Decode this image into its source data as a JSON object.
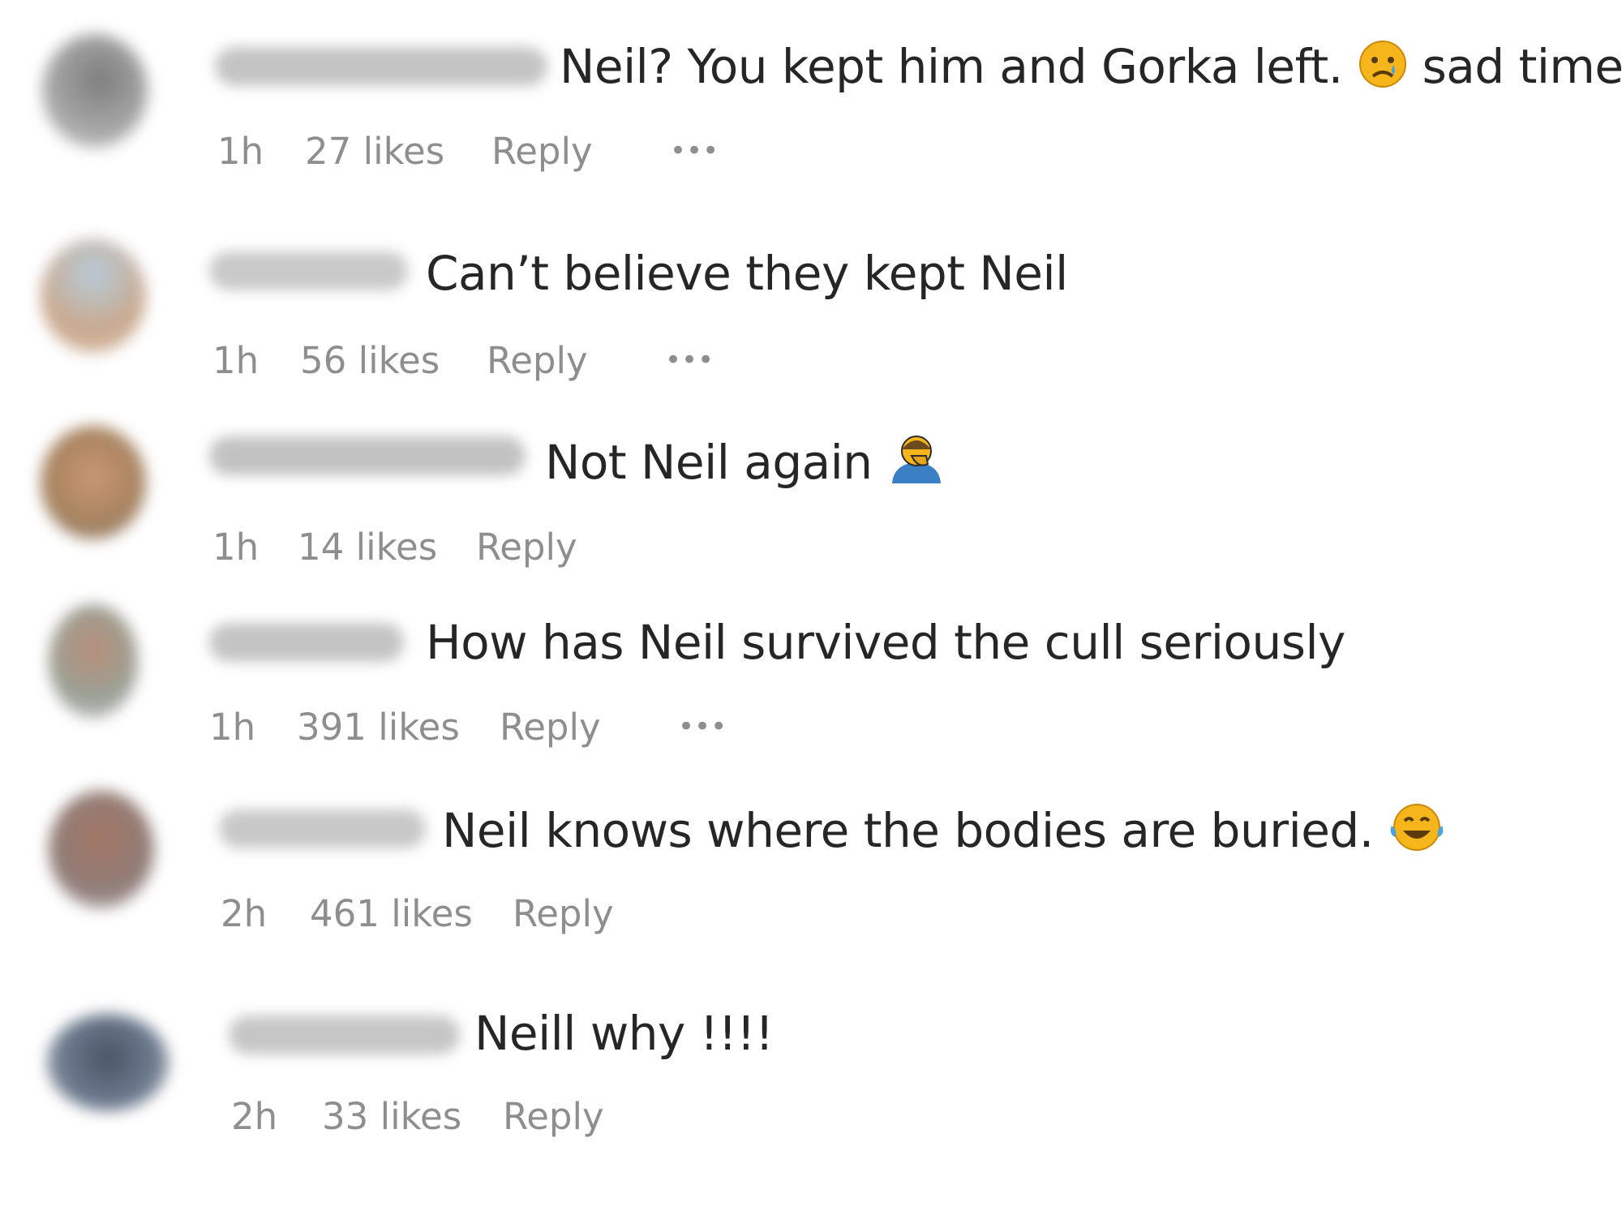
{
  "comments": [
    {
      "text": "Neil? You kept him and Gorka left.",
      "text_suffix": "sad times",
      "emoji": "sad-face-icon",
      "time": "1h",
      "likes": "27 likes",
      "reply": "Reply",
      "more": "•••"
    },
    {
      "text": "Can’t believe they kept Neil",
      "time": "1h",
      "likes": "56 likes",
      "reply": "Reply",
      "more": "•••"
    },
    {
      "text": "Not Neil again",
      "emoji": "facepalm-icon",
      "time": "1h",
      "likes": "14 likes",
      "reply": "Reply"
    },
    {
      "text": "How has Neil survived the cull seriously",
      "time": "1h",
      "likes": "391 likes",
      "reply": "Reply",
      "more": "•••"
    },
    {
      "text": "Neil knows where the bodies are buried.",
      "emoji": "laughing-crying-icon",
      "time": "2h",
      "likes": "461 likes",
      "reply": "Reply"
    },
    {
      "text": "Neill why !!!!",
      "time": "2h",
      "likes": "33 likes",
      "reply": "Reply"
    }
  ],
  "colors": {
    "text": "#262626",
    "meta": "#8e8e8e",
    "emoji_yellow": "#f5b51b",
    "emoji_blue": "#3b7fc4"
  }
}
